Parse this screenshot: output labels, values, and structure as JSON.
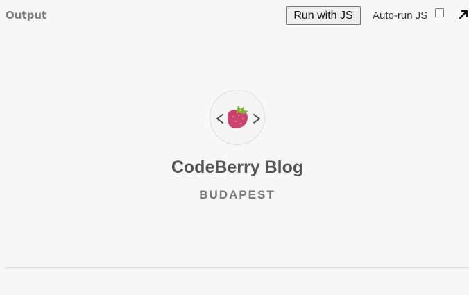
{
  "toolbar": {
    "output_label": "Output",
    "run_button_label": "Run with JS",
    "autorun_label": "Auto-run JS",
    "autorun_checked": false
  },
  "header": {
    "title": "CodeBerry Blog",
    "subtitle": "BUDAPEST",
    "logo_icon": "strawberry-code-icon"
  },
  "colors": {
    "background": "#f7f7f7",
    "title": "#555555",
    "subtitle": "#777777",
    "strawberry": "#c9446f",
    "leaf": "#7cb342"
  }
}
